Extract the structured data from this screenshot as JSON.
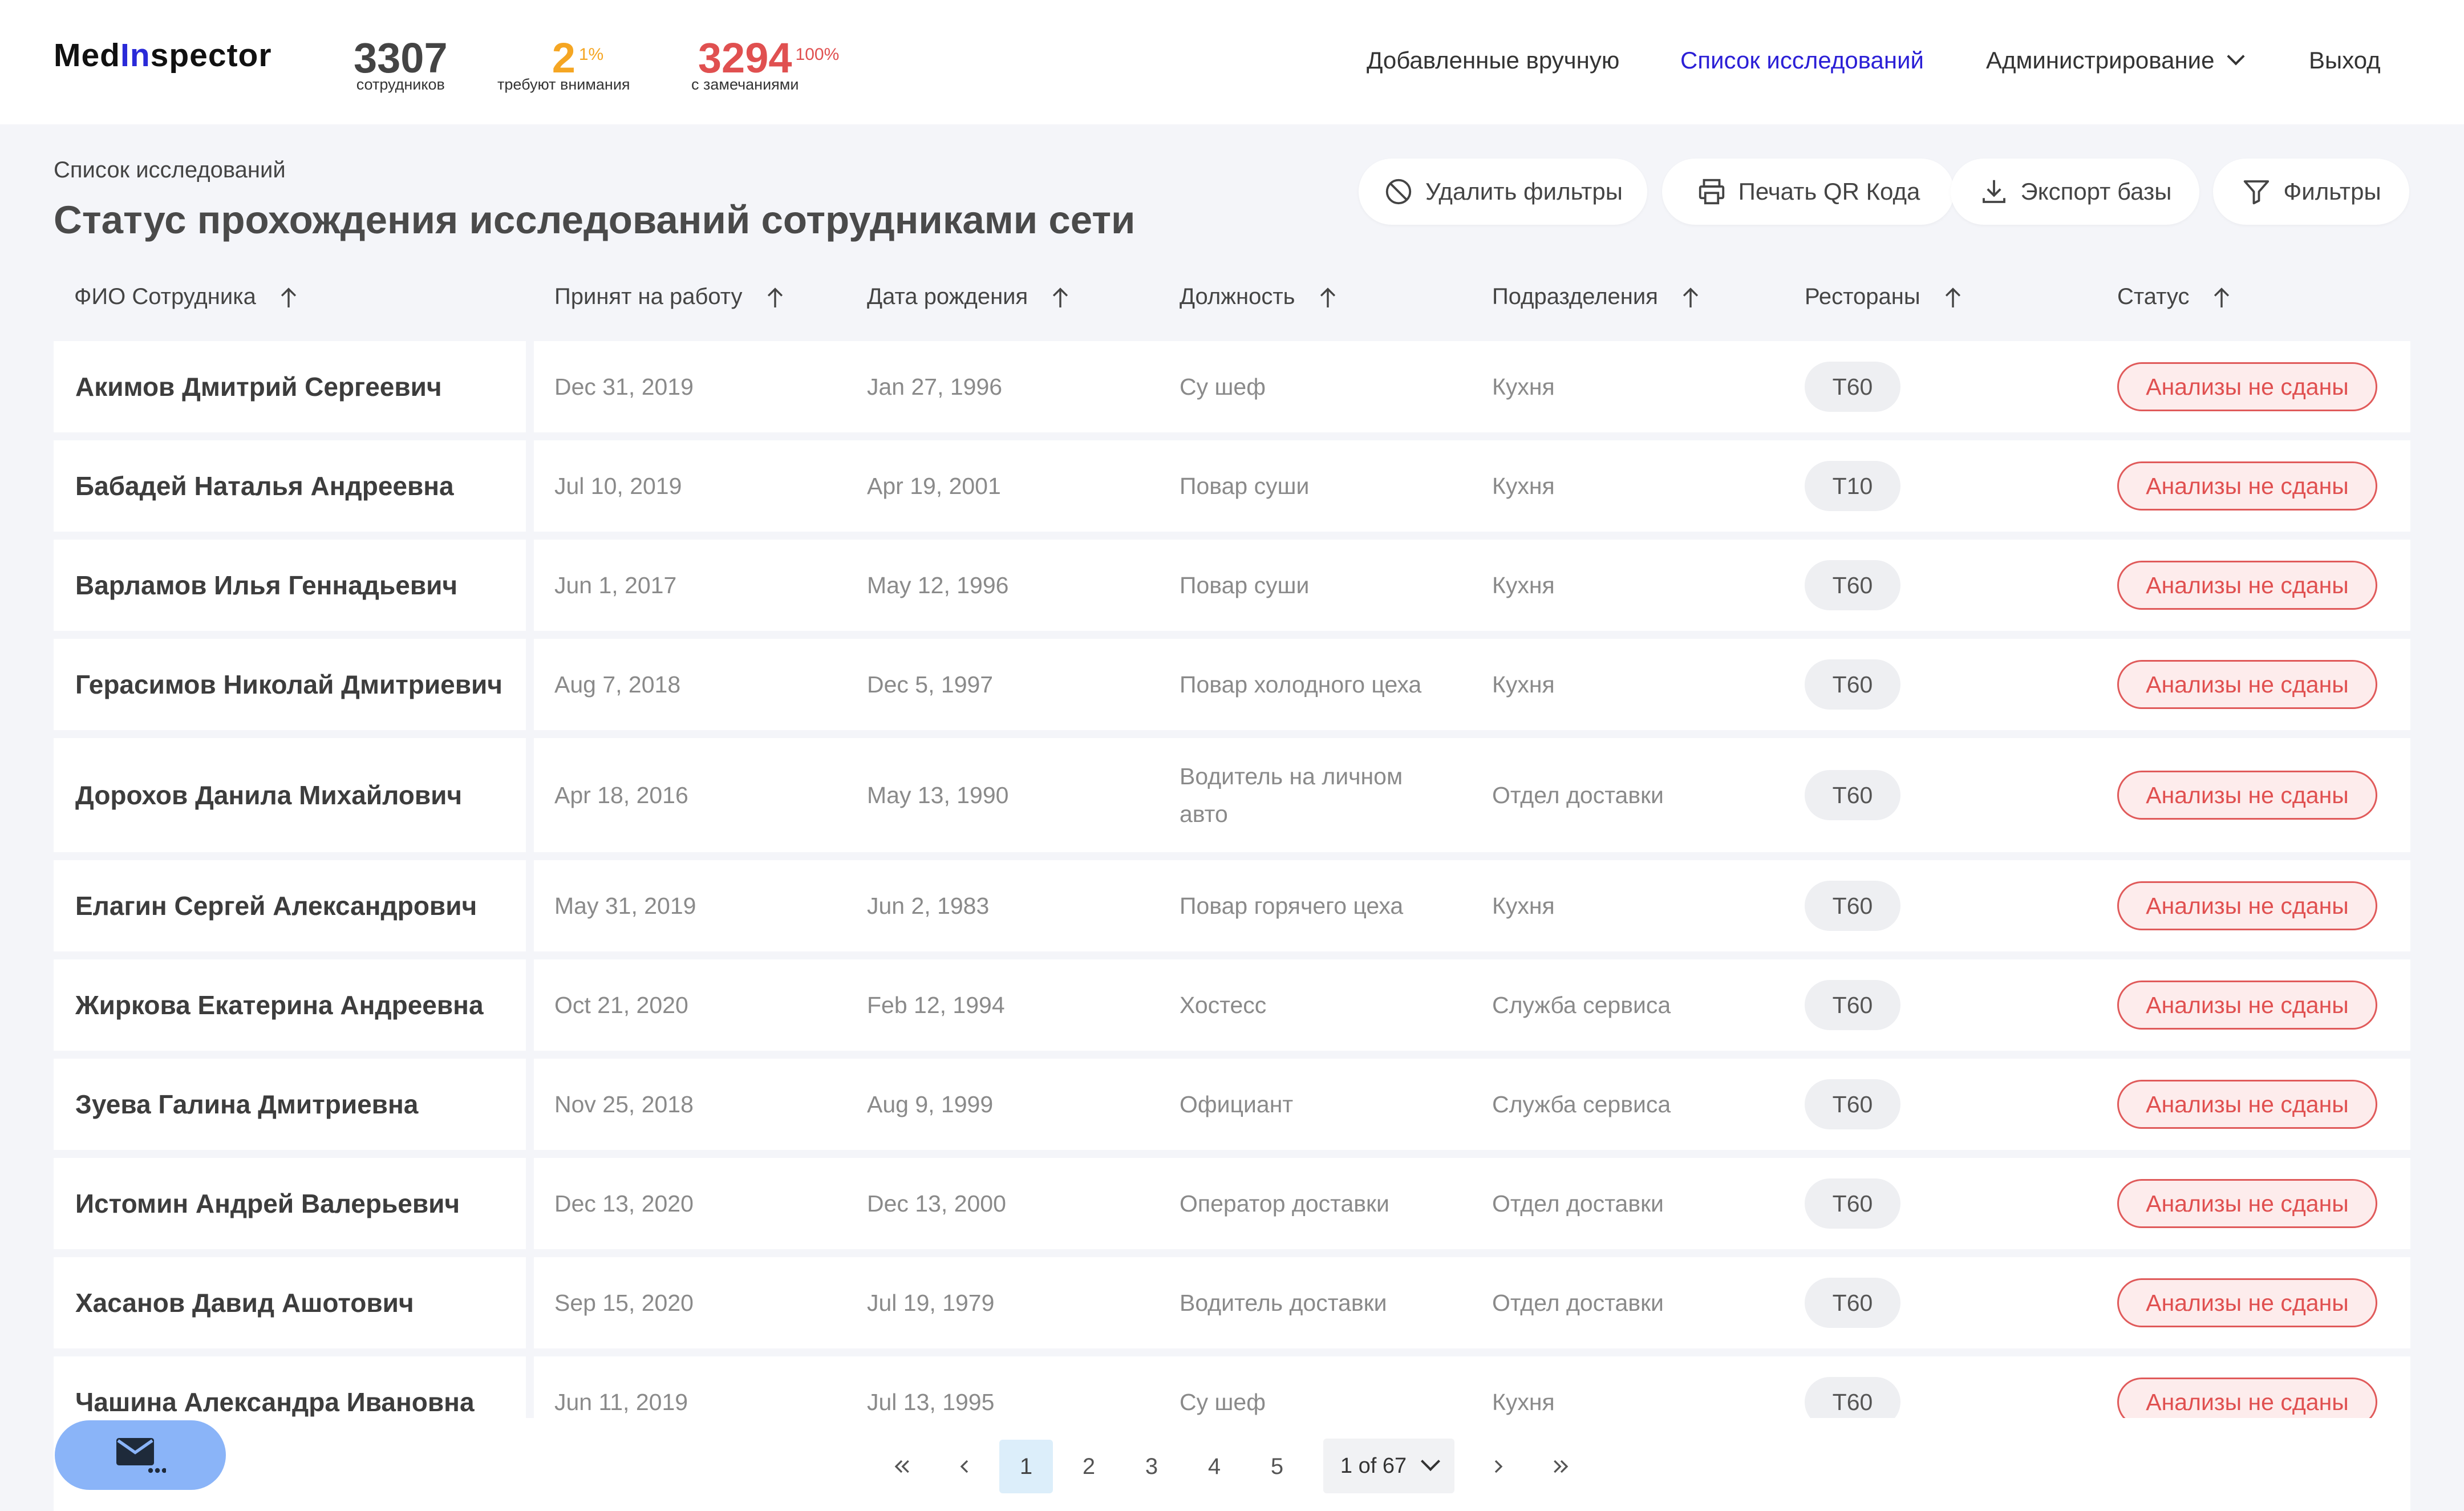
{
  "app": {
    "logo_part1": "Med",
    "logo_part2": "In",
    "logo_part3": "spector",
    "colors": {
      "accent": "#2b1fd6",
      "attention": "#f5a623",
      "danger": "#e05050"
    }
  },
  "stats": [
    {
      "value": "3307",
      "pct": "",
      "label": "сотрудников",
      "color": "#444444"
    },
    {
      "value": "2",
      "pct": "1%",
      "label": "требуют внимания",
      "color": "#f5a623"
    },
    {
      "value": "3294",
      "pct": "100%",
      "label": "с замечаниями",
      "color": "#e05050"
    }
  ],
  "nav": {
    "manual": "Добавленные вручную",
    "list": "Список исследований",
    "admin": "Администрирование",
    "logout": "Выход"
  },
  "page": {
    "breadcrumb": "Список исследований",
    "title": "Статус прохождения исследований сотрудниками сети"
  },
  "toolbar": {
    "clear_filters": "Удалить фильтры",
    "print_qr": "Печать QR Кода",
    "export": "Экспорт базы",
    "filters": "Фильтры"
  },
  "table": {
    "headers": {
      "name": "ФИО Сотрудника",
      "hired": "Принят на работу",
      "birth": "Дата рождения",
      "position": "Должность",
      "department": "Подразделения",
      "restaurant": "Рестораны",
      "status": "Статус"
    },
    "rows": [
      {
        "name": "Акимов Дмитрий Сергеевич",
        "hired": "Dec 31, 2019",
        "birth": "Jan 27, 1996",
        "position": "Су шеф",
        "department": "Кухня",
        "restaurant": "Т60",
        "status": "Анализы не сданы"
      },
      {
        "name": "Бабадей Наталья Андреевна",
        "hired": "Jul 10, 2019",
        "birth": "Apr 19, 2001",
        "position": "Повар суши",
        "department": "Кухня",
        "restaurant": "Т10",
        "status": "Анализы не сданы"
      },
      {
        "name": "Варламов Илья Геннадьевич",
        "hired": "Jun 1, 2017",
        "birth": "May 12, 1996",
        "position": "Повар суши",
        "department": "Кухня",
        "restaurant": "Т60",
        "status": "Анализы не сданы"
      },
      {
        "name": "Герасимов Николай Дмитриевич",
        "hired": "Aug 7, 2018",
        "birth": "Dec 5, 1997",
        "position": "Повар холодного цеха",
        "department": "Кухня",
        "restaurant": "Т60",
        "status": "Анализы не сданы"
      },
      {
        "name": "Дорохов Данила Михайлович",
        "hired": "Apr 18, 2016",
        "birth": "May 13, 1990",
        "position_l1": "Водитель на личном",
        "position_l2": "авто",
        "department": "Отдел доставки",
        "restaurant": "Т60",
        "status": "Анализы не сданы"
      },
      {
        "name": "Елагин Сергей Александрович",
        "hired": "May 31, 2019",
        "birth": "Jun 2, 1983",
        "position": "Повар горячего цеха",
        "department": "Кухня",
        "restaurant": "Т60",
        "status": "Анализы не сданы"
      },
      {
        "name": "Жиркова Екатерина Андреевна",
        "hired": "Oct 21, 2020",
        "birth": "Feb 12, 1994",
        "position": "Хостесс",
        "department": "Служба сервиса",
        "restaurant": "Т60",
        "status": "Анализы не сданы"
      },
      {
        "name": "Зуева Галина Дмитриевна",
        "hired": "Nov 25, 2018",
        "birth": "Aug 9, 1999",
        "position": "Официант",
        "department": "Служба сервиса",
        "restaurant": "Т60",
        "status": "Анализы не сданы"
      },
      {
        "name": "Истомин Андрей Валерьевич",
        "hired": "Dec 13, 2020",
        "birth": "Dec 13, 2000",
        "position": "Оператор доставки",
        "department": "Отдел доставки",
        "restaurant": "Т60",
        "status": "Анализы не сданы"
      },
      {
        "name": "Хасанов Давид Ашотович",
        "hired": "Sep 15, 2020",
        "birth": "Jul 19, 1979",
        "position": "Водитель доставки",
        "department": "Отдел доставки",
        "restaurant": "Т60",
        "status": "Анализы не сданы"
      },
      {
        "name": "Чашина Александра Ивановна",
        "hired": "Jun 11, 2019",
        "birth": "Jul 13, 1995",
        "position": "Су шеф",
        "department": "Кухня",
        "restaurant": "Т60",
        "status": "Анализы не сданы"
      }
    ]
  },
  "pagination": {
    "pages": [
      "1",
      "2",
      "3",
      "4",
      "5"
    ],
    "current": "1",
    "select_label": "1 of 67"
  },
  "icons": {
    "clear_filters": "ban-icon",
    "print": "printer-icon",
    "export": "download-icon",
    "filters": "funnel-icon",
    "sort": "arrow-up-icon",
    "mail": "mail-icon"
  }
}
